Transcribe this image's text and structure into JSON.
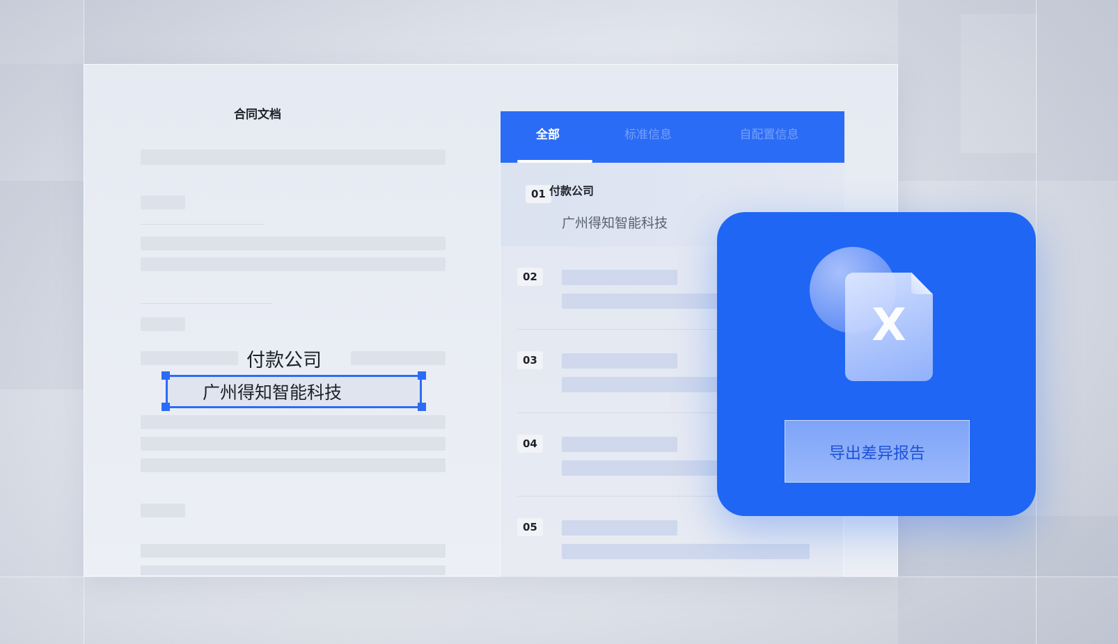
{
  "document": {
    "title": "合同文档",
    "highlight": {
      "label": "付款公司",
      "value": "广州得知智能科技"
    }
  },
  "panel": {
    "tabs": [
      {
        "label": "全部",
        "active": true
      },
      {
        "label": "标准信息",
        "active": false
      },
      {
        "label": "自配置信息",
        "active": false
      }
    ],
    "rows": [
      {
        "num": "01",
        "title": "付款公司",
        "value": "广州得知智能科技"
      },
      {
        "num": "02"
      },
      {
        "num": "03"
      },
      {
        "num": "04"
      },
      {
        "num": "05"
      }
    ]
  },
  "export_card": {
    "icon": "excel-file-icon",
    "icon_letter": "X",
    "button_label": "导出差异报告"
  },
  "colors": {
    "accent": "#2b6cf6",
    "card": "#1f66f4"
  }
}
